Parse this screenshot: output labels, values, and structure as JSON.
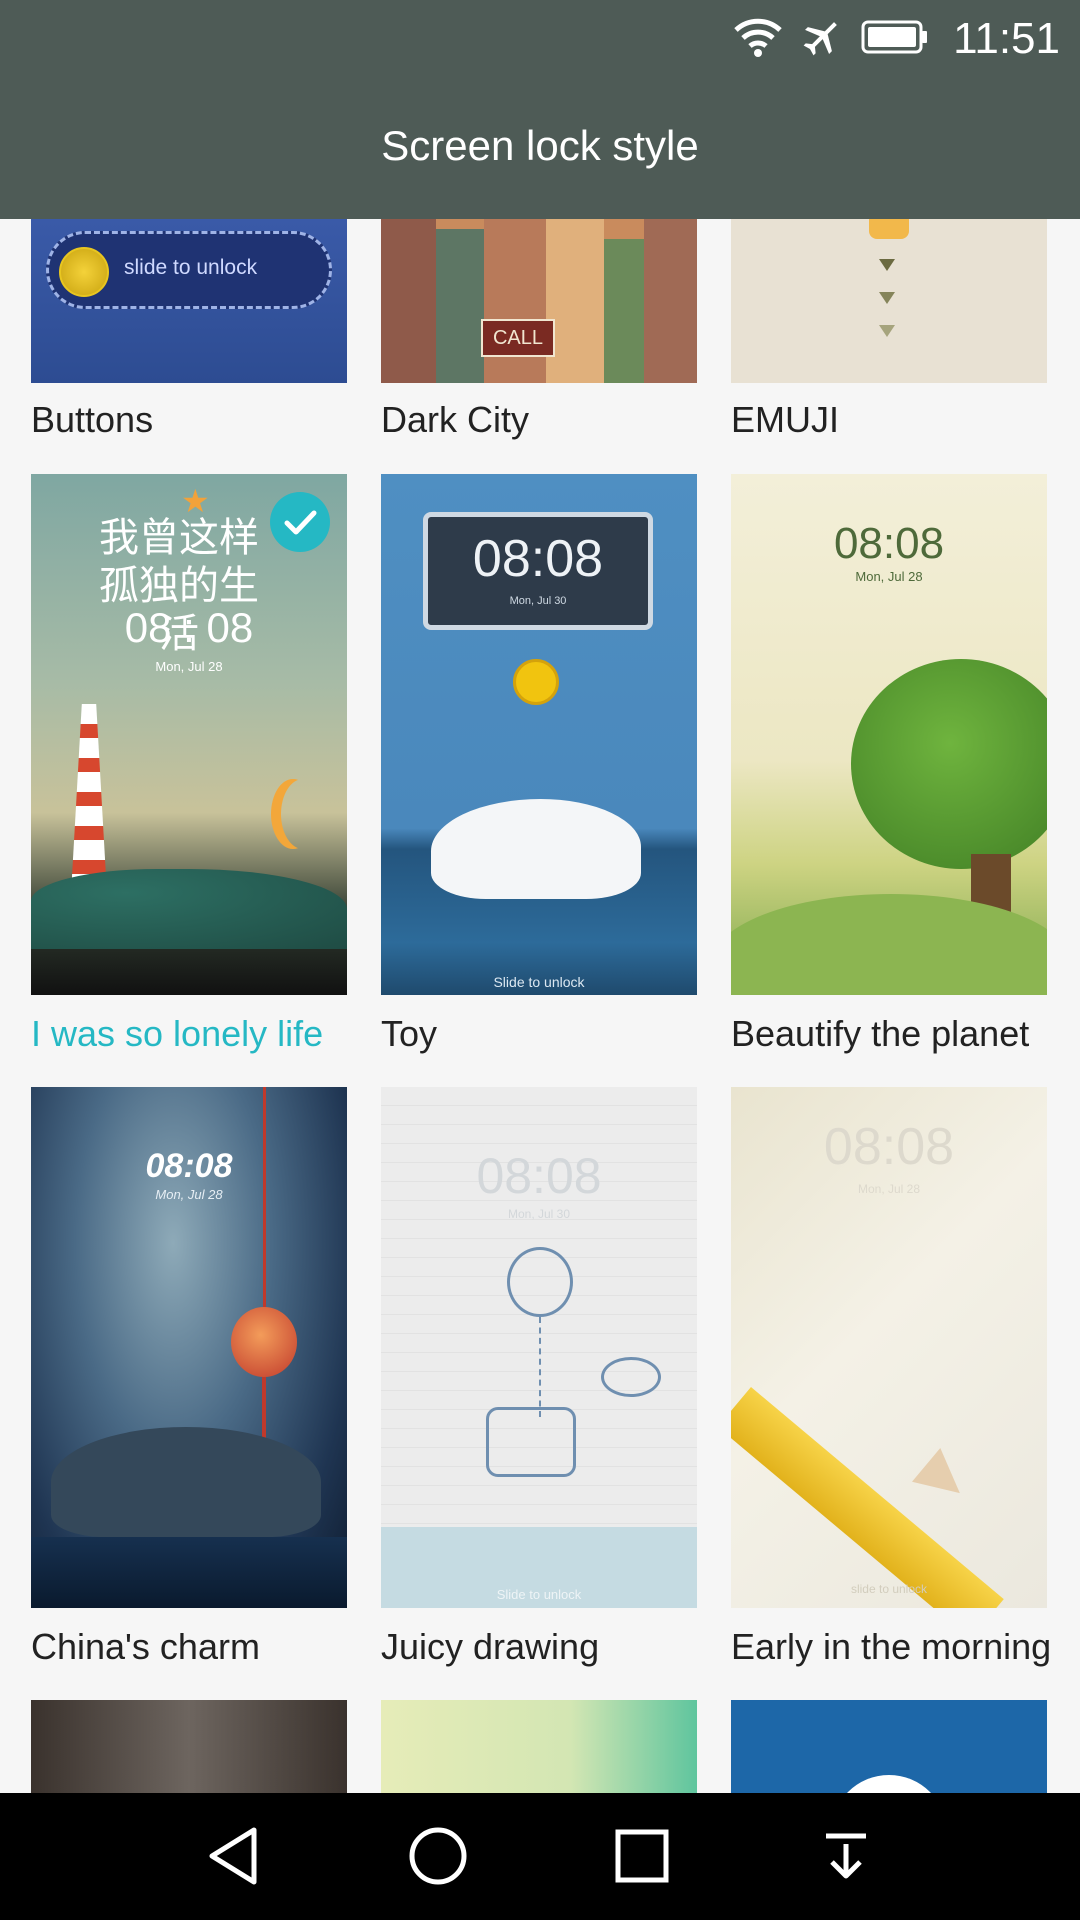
{
  "status_bar": {
    "time": "11:51"
  },
  "header": {
    "title": "Screen lock style"
  },
  "themes": [
    {
      "name": "Buttons",
      "preview_text": "slide to unlock"
    },
    {
      "name": "Dark City",
      "preview_text": "CALL"
    },
    {
      "name": "EMUJI"
    },
    {
      "name": "I was so lonely life",
      "selected": true,
      "preview_time": "08 : 08",
      "preview_date": "Mon,  Jul 28",
      "preview_text": "我曾这样 孤独的生活"
    },
    {
      "name": "Toy",
      "preview_time": "08:08",
      "preview_date": "Mon, Jul 30",
      "preview_text": "Slide to unlock"
    },
    {
      "name": "Beautify the planet",
      "preview_time": "08:08",
      "preview_date": "Mon,  Jul 28"
    },
    {
      "name": "China's charm",
      "preview_time": "08:08",
      "preview_date": "Mon,  Jul 28"
    },
    {
      "name": "Juicy drawing",
      "preview_time": "08:08",
      "preview_date": "Mon, Jul 30",
      "preview_text": "Slide to unlock"
    },
    {
      "name": "Early in the morning",
      "preview_time": "08:08",
      "preview_date": "Mon,  Jul 28",
      "preview_text": "slide to unlock"
    }
  ],
  "colors": {
    "header_bg": "#4e5b56",
    "selected": "#25b8c4",
    "nav_bg": "#000000"
  }
}
